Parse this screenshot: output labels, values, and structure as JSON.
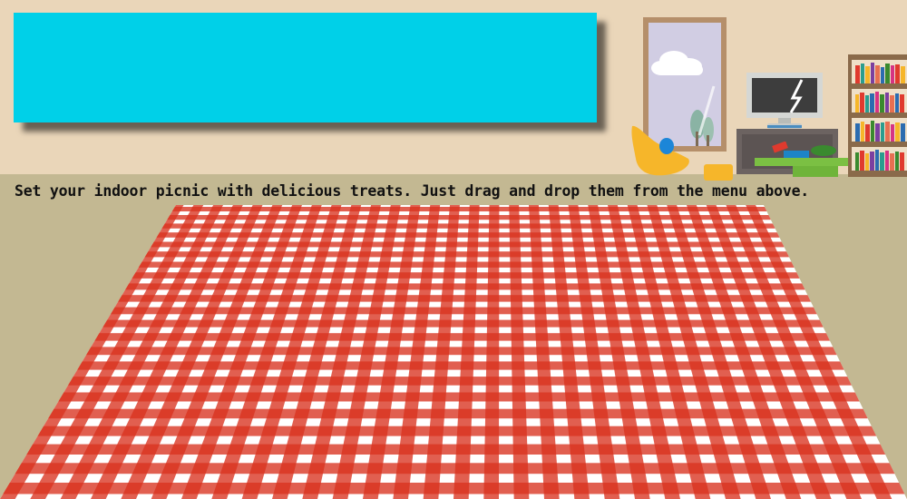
{
  "instructions": "Set your indoor picnic with delicious treats. Just drag and drop them from the menu above.",
  "colors": {
    "wall": "#ead6b9",
    "floor": "#c3b892",
    "menu_panel": "#00d0e8",
    "tablecloth_red": "#d8321f",
    "tablecloth_white": "#ffffff"
  },
  "icons": [
    "window",
    "cloud",
    "tree",
    "chair",
    "computer-monitor",
    "desk",
    "toy-truck",
    "bookshelf",
    "floor-cushion"
  ]
}
